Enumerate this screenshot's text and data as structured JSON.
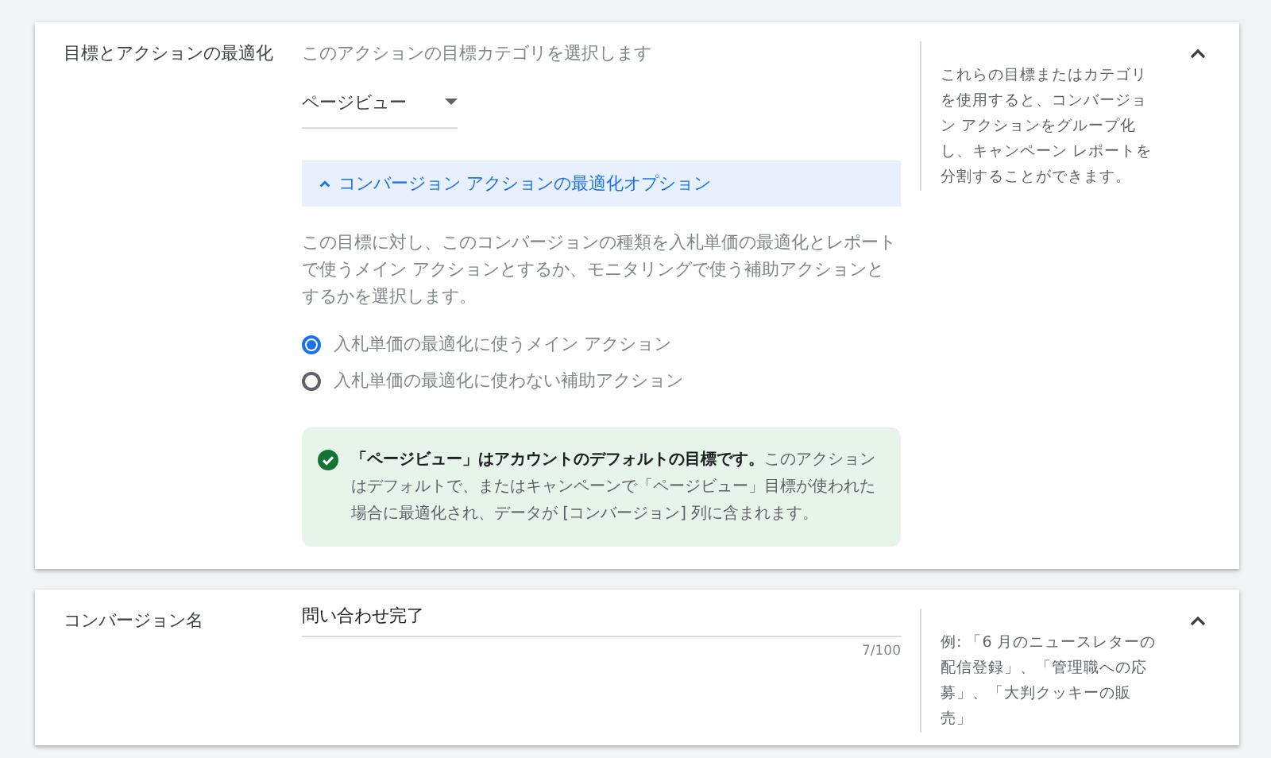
{
  "sections": [
    {
      "kind": "goal",
      "label": "目標とアクションの最適化",
      "expanded": true,
      "help": "これらの目標またはカテゴリを使用すると、コンバージョン アクションをグループ化し、キャンペーン レポートを分割することができます。",
      "prompt": "このアクションの目標カテゴリを選択します",
      "dropdown": {
        "value": "ページビュー"
      },
      "options_panel": {
        "title": "コンバージョン アクションの最適化オプション",
        "expanded": true,
        "description": "この目標に対し、このコンバージョンの種類を入札単価の最適化とレポートで使うメイン アクションとするか、モニタリングで使う補助アクションとするかを選択します。",
        "radios": [
          {
            "label": "入札単価の最適化に使うメイン アクション",
            "selected": true
          },
          {
            "label": "入札単価の最適化に使わない補助アクション",
            "selected": false
          }
        ],
        "notice": "**「ページビュー」はアカウントのデフォルトの目標です。**このアクションはデフォルトで、またはキャンペーンで「ページビュー」目標が使われた場合に最適化され、データが [コンバージョン] 列に含まれます。"
      }
    },
    {
      "kind": "name",
      "label": "コンバージョン名",
      "expanded": true,
      "help": "例: 「6 月のニュースレターの配信登録」、「管理職への応募」、「大判クッキーの販売」",
      "input": {
        "value": "問い合わせ完了",
        "counter": "7/100"
      }
    }
  ]
}
